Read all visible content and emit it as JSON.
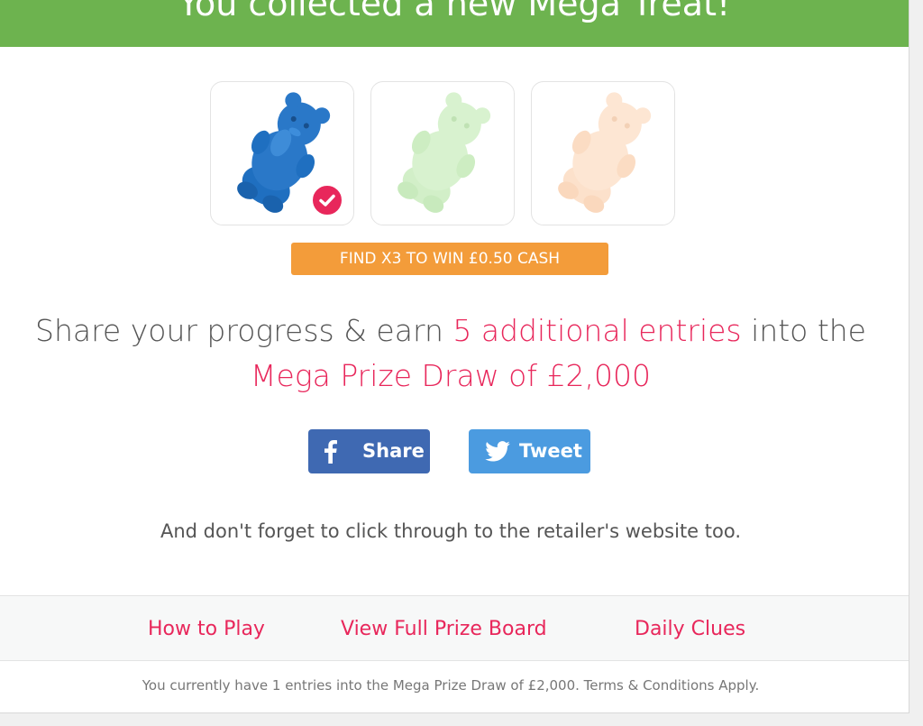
{
  "header": {
    "title": "You collected a new Mega Treat!",
    "color": "#6db34f"
  },
  "treats": [
    {
      "icon": "gummy-bear-icon",
      "color": "#2a78c8",
      "collected": true
    },
    {
      "icon": "gummy-bear-icon",
      "color": "#d8f2cf",
      "collected": false
    },
    {
      "icon": "gummy-bear-icon",
      "color": "#fde6d3",
      "collected": false
    }
  ],
  "goal_badge": {
    "label": "FIND X3 TO WIN £0.50 CASH",
    "color": "#f39c3a"
  },
  "share_prompt": {
    "prefix": "Share your progress & earn ",
    "highlight": "5 additional entries",
    "suffix": " into the",
    "prize": "Mega Prize Draw of £2,000",
    "accent_color": "#e8275b"
  },
  "social": {
    "facebook_label": "Share",
    "twitter_label": "Tweet",
    "facebook_color": "#3f69b2",
    "twitter_color": "#4b9be0"
  },
  "reminder": "And don't forget to click through to the retailer's website too.",
  "footer": {
    "links": [
      "How to Play",
      "View Full Prize Board",
      "Daily Clues"
    ]
  },
  "entries_note": "You currently have 1 entries into the Mega Prize Draw of £2,000. Terms & Conditions Apply."
}
